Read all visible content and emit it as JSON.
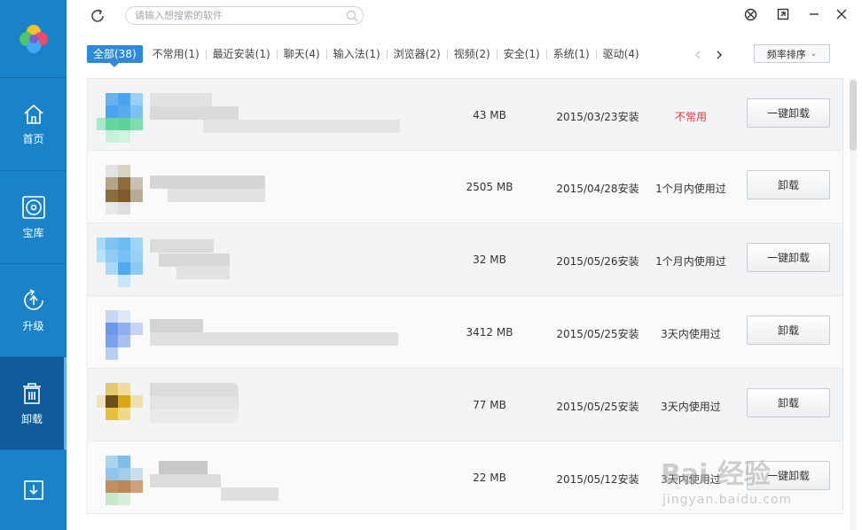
{
  "sidebar": {
    "items": [
      {
        "label": "首页",
        "icon": "home-icon"
      },
      {
        "label": "宝库",
        "icon": "disc-icon"
      },
      {
        "label": "升级",
        "icon": "upgrade-icon"
      },
      {
        "label": "卸载",
        "icon": "trash-icon",
        "active": true
      },
      {
        "label": "",
        "icon": "download-icon"
      }
    ]
  },
  "search": {
    "placeholder": "请输入想搜索的软件"
  },
  "tabs": [
    {
      "label": "全部(38)",
      "active": true
    },
    {
      "label": "不常用(1)"
    },
    {
      "label": "最近安装(1)"
    },
    {
      "label": "聊天(4)"
    },
    {
      "label": "输入法(1)"
    },
    {
      "label": "浏览器(2)"
    },
    {
      "label": "视频(2)"
    },
    {
      "label": "安全(1)"
    },
    {
      "label": "系统(1)"
    },
    {
      "label": "驱动(4)"
    }
  ],
  "sort": {
    "label": "频率排序"
  },
  "rows": [
    {
      "size": "43 MB",
      "date": "2015/03/23安装",
      "usage": "不常用",
      "warn": true,
      "action": "一键卸载"
    },
    {
      "size": "2505 MB",
      "date": "2015/04/28安装",
      "usage": "1个月内使用过",
      "action": "卸载"
    },
    {
      "size": "32 MB",
      "date": "2015/05/26安装",
      "usage": "1个月内使用过",
      "action": "一键卸载"
    },
    {
      "size": "3412 MB",
      "date": "2015/05/25安装",
      "usage": "3天内使用过",
      "action": "卸载"
    },
    {
      "size": "77 MB",
      "date": "2015/05/25安装",
      "usage": "3天内使用过",
      "action": "卸载"
    },
    {
      "size": "22 MB",
      "date": "2015/05/12安装",
      "usage": "3天内使用过",
      "action": "一键卸载"
    }
  ],
  "watermark": {
    "brand": "Bai 经验",
    "url": "jingyan.baidu.com"
  },
  "colors": {
    "sidebar": "#1a82c8",
    "sidebar_active": "#0e5a9a",
    "accent": "#2e8ad6",
    "warn": "#e0353b"
  }
}
